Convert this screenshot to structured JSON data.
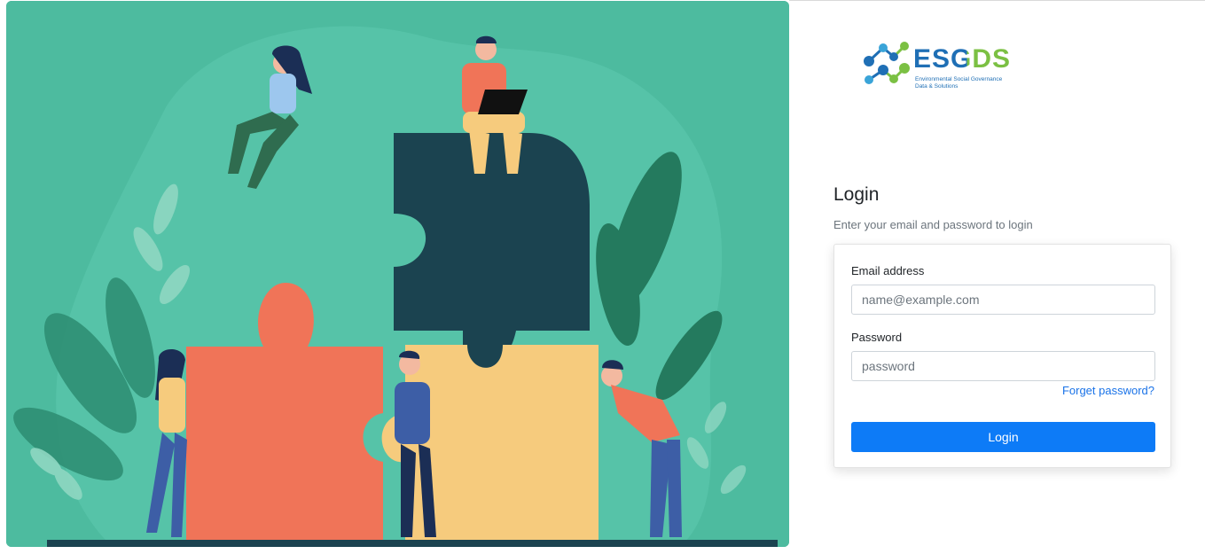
{
  "logo": {
    "name": "ESGDS",
    "tagline_line1": "Environmental Social Governance",
    "tagline_line2": "Data & Solutions"
  },
  "login": {
    "title": "Login",
    "subtitle": "Enter your email and password to login",
    "email_label": "Email address",
    "email_placeholder": "name@example.com",
    "email_value": "",
    "password_label": "Password",
    "password_placeholder": "password",
    "password_value": "",
    "forget_link": "Forget password?",
    "submit_label": "Login"
  },
  "colors": {
    "hero_bg": "#4dbb9f",
    "primary": "#0d7bf7",
    "link": "#1a73e8",
    "puzzle_dark": "#1b4350",
    "puzzle_orange": "#f07458",
    "puzzle_yellow": "#f6cb7d",
    "logo_blue": "#1f6fb5",
    "logo_green": "#7bc043"
  }
}
